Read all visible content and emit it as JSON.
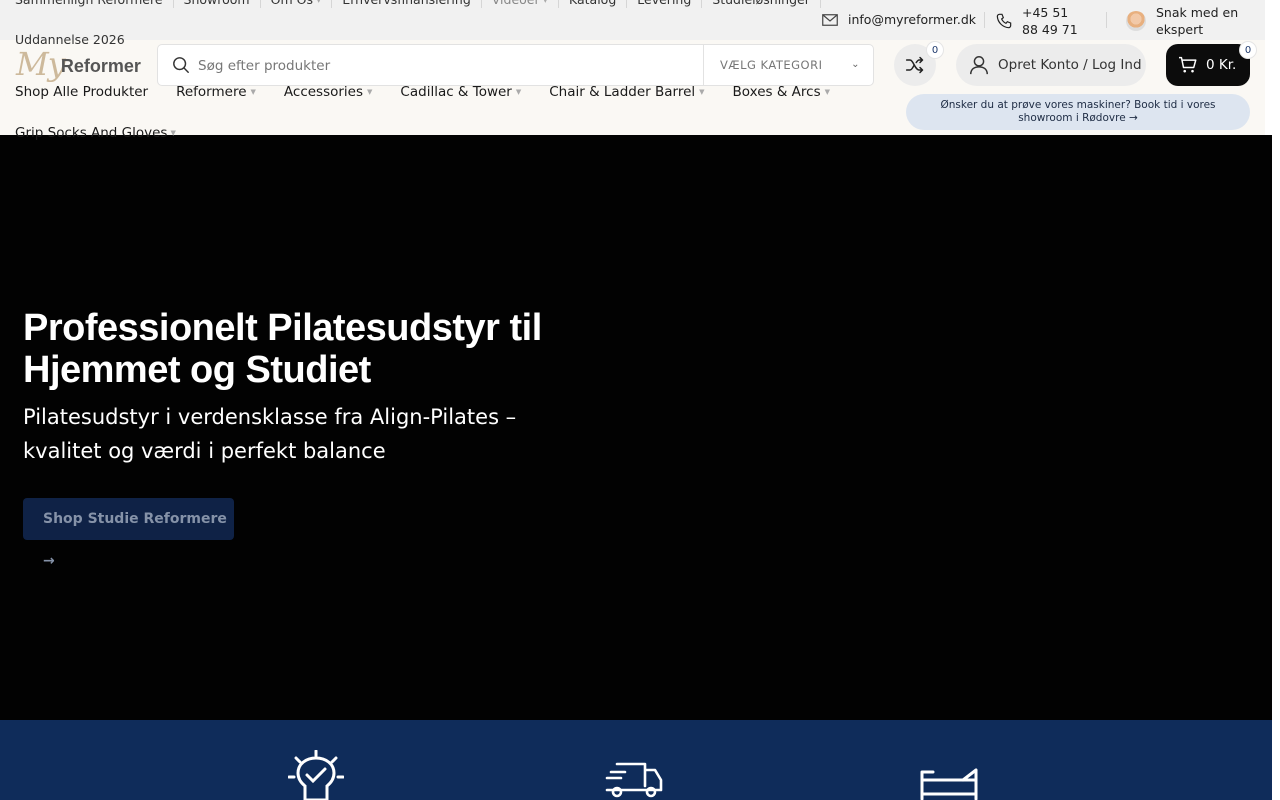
{
  "topbar": {
    "nav": [
      {
        "label": "Sammenlign Reformere",
        "caret": false,
        "muted": false
      },
      {
        "label": "Showroom",
        "caret": false,
        "muted": false
      },
      {
        "label": "Om Os",
        "caret": true,
        "muted": false
      },
      {
        "label": "Erhvervsfinansiering",
        "caret": false,
        "muted": false
      },
      {
        "label": "Videoer",
        "caret": true,
        "muted": true
      },
      {
        "label": "Katalog",
        "caret": false,
        "muted": false
      },
      {
        "label": "Levering",
        "caret": false,
        "muted": false
      },
      {
        "label": "Studieløsninger",
        "caret": false,
        "muted": false
      }
    ],
    "nav_row2": "Uddannelse 2026",
    "email": "info@myreformer.dk",
    "phone": "+45 51 88 49 71",
    "expert": "Snak med en ekspert"
  },
  "header": {
    "logo_my": "My",
    "logo_reformer": "Reformer",
    "search_placeholder": "Søg efter produkter",
    "category_label": "VÆLG KATEGORI",
    "compare_count": "0",
    "account_label": "Opret Konto / Log Ind",
    "cart_label": "0 Kr.",
    "cart_count": "0",
    "promo": "Ønsker du at prøve vores maskiner? Book tid i vores showroom i Rødovre →"
  },
  "mainnav": {
    "items": [
      {
        "label": "Shop Alle Produkter",
        "caret": false
      },
      {
        "label": "Reformere",
        "caret": true
      },
      {
        "label": "Accessories",
        "caret": true
      },
      {
        "label": "Cadillac & Tower",
        "caret": true
      },
      {
        "label": "Chair & Ladder Barrel",
        "caret": true
      },
      {
        "label": "Boxes & Arcs",
        "caret": true
      }
    ],
    "row2": "Grip Socks And Gloves"
  },
  "hero": {
    "title": "Professionelt Pilatesudstyr til Hjemmet og Studiet",
    "subtitle": "Pilatesudstyr i verdensklasse fra Align-Pilates – kvalitet og værdi i perfekt balance",
    "button": "Shop Studie Reformere →"
  },
  "features": {
    "icons": [
      "lightbulb-check-icon",
      "delivery-truck-icon",
      "reformer-bed-icon"
    ]
  },
  "colors": {
    "hero_bg": "#020202",
    "features_bg": "#0f2c5a",
    "button_bg": "#0f2246",
    "cart_bg": "#0c0c0c",
    "promo_bg": "#dde5f0"
  }
}
